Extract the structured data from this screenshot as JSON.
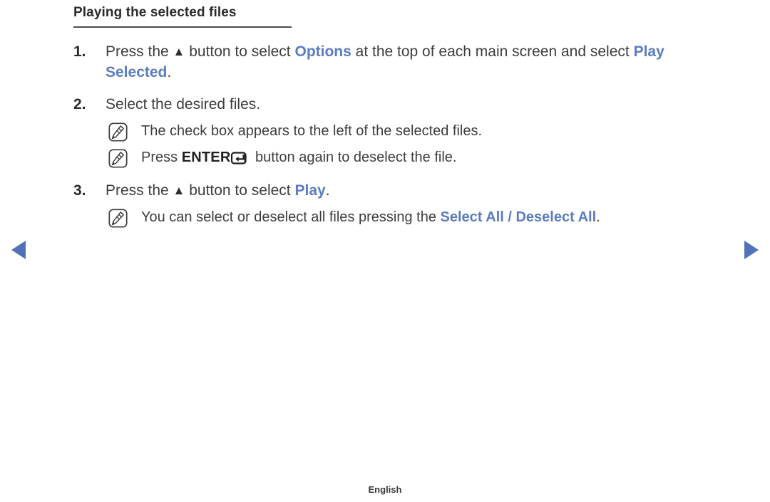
{
  "page": {
    "heading": "Playing the selected files",
    "footer_language": "English",
    "accent_color": "#5b7cc0",
    "nav_arrow_color": "#5272b8"
  },
  "nav": {
    "prev_icon": "triangle-left-icon",
    "next_icon": "triangle-right-icon"
  },
  "steps": [
    {
      "number": "1.",
      "parts": [
        {
          "type": "text",
          "value": "Press the "
        },
        {
          "type": "glyph",
          "value": "▲",
          "name": "up-arrow-glyph"
        },
        {
          "type": "text",
          "value": " button to select "
        },
        {
          "type": "highlight",
          "value": "Options"
        },
        {
          "type": "text",
          "value": " at the top of each main screen and select "
        },
        {
          "type": "highlight",
          "value": "Play Selected"
        },
        {
          "type": "text",
          "value": "."
        }
      ],
      "notes": []
    },
    {
      "number": "2.",
      "parts": [
        {
          "type": "text",
          "value": "Select the desired files."
        }
      ],
      "notes": [
        {
          "icon": "note-pencil-icon",
          "parts": [
            {
              "type": "text",
              "value": "The check box appears to the left of the selected files."
            }
          ]
        },
        {
          "icon": "note-pencil-icon",
          "parts": [
            {
              "type": "text",
              "value": "Press "
            },
            {
              "type": "kbd",
              "value": "ENTER"
            },
            {
              "type": "enter_glyph",
              "value": "enter-key-icon"
            },
            {
              "type": "text",
              "value": " button again to deselect the file."
            }
          ]
        }
      ]
    },
    {
      "number": "3.",
      "parts": [
        {
          "type": "text",
          "value": "Press the "
        },
        {
          "type": "glyph",
          "value": "▲",
          "name": "up-arrow-glyph"
        },
        {
          "type": "text",
          "value": " button to select "
        },
        {
          "type": "highlight",
          "value": "Play"
        },
        {
          "type": "text",
          "value": "."
        }
      ],
      "notes": [
        {
          "icon": "note-pencil-icon",
          "parts": [
            {
              "type": "text",
              "value": "You can select or deselect all files pressing the "
            },
            {
              "type": "highlight",
              "value": "Select All / Deselect All"
            },
            {
              "type": "text",
              "value": "."
            }
          ]
        }
      ]
    }
  ]
}
